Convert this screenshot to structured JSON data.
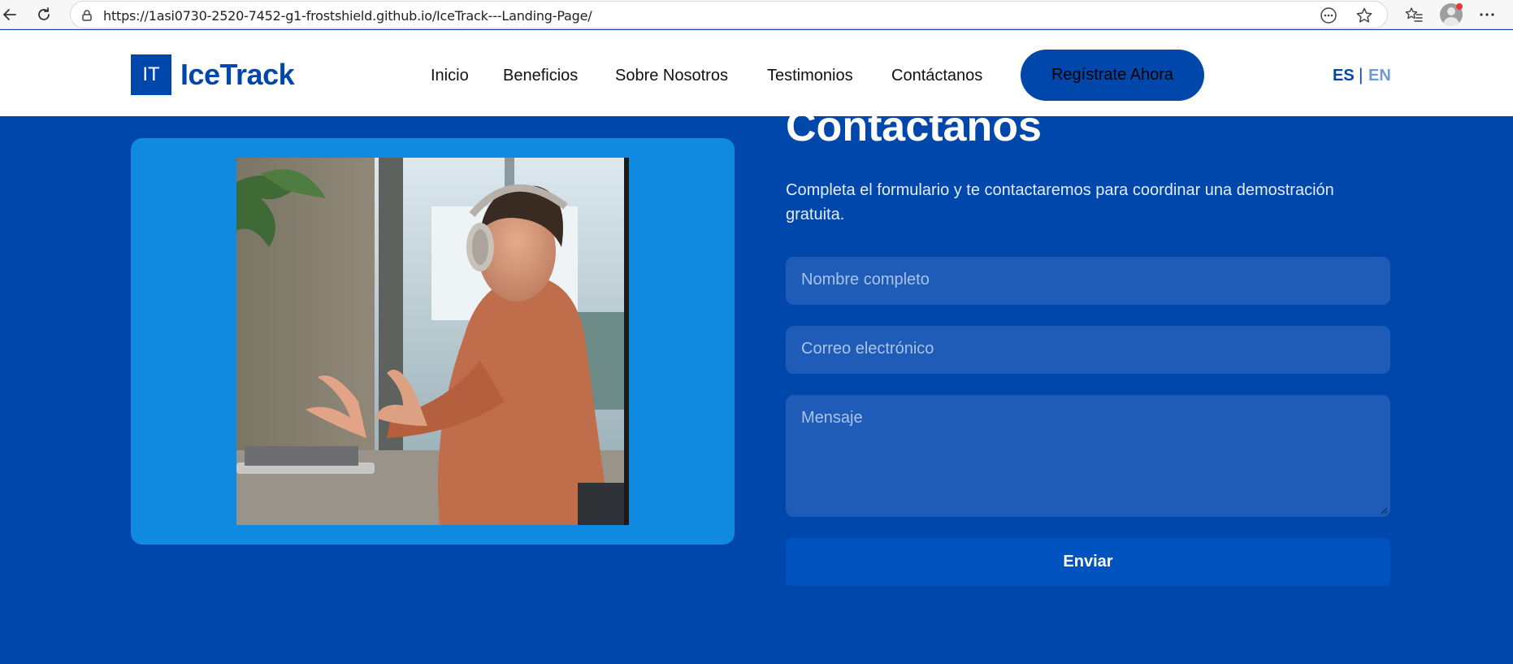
{
  "browser": {
    "url": "https://1asi0730-2520-7452-g1-frostshield.github.io/IceTrack---Landing-Page/",
    "icons": [
      "back-arrow-icon",
      "reload-icon",
      "lock-icon",
      "more-circle-icon",
      "star-icon",
      "favorites-icon",
      "profile-icon",
      "menu-dots-icon"
    ]
  },
  "header": {
    "logo_mark": "IT",
    "logo_text": "IceTrack",
    "nav": [
      "Inicio",
      "Beneficios",
      "Sobre Nosotros",
      "Testimonios",
      "Contáctanos"
    ],
    "cta_label": "Regístrate Ahora",
    "lang_es": "ES",
    "lang_sep": "|",
    "lang_en": "EN"
  },
  "contact": {
    "title": "Contáctanos",
    "description": "Completa el formulario y te contactaremos para coordinar una demostración gratuita.",
    "name_placeholder": "Nombre completo",
    "email_placeholder": "Correo electrónico",
    "message_placeholder": "Mensaje",
    "submit_label": "Enviar"
  },
  "colors": {
    "brand": "#0047AB",
    "card": "#0F8AE0",
    "field": "#1E5CB8",
    "button": "#0052BF",
    "lang_inactive": "#6E9BD8"
  }
}
